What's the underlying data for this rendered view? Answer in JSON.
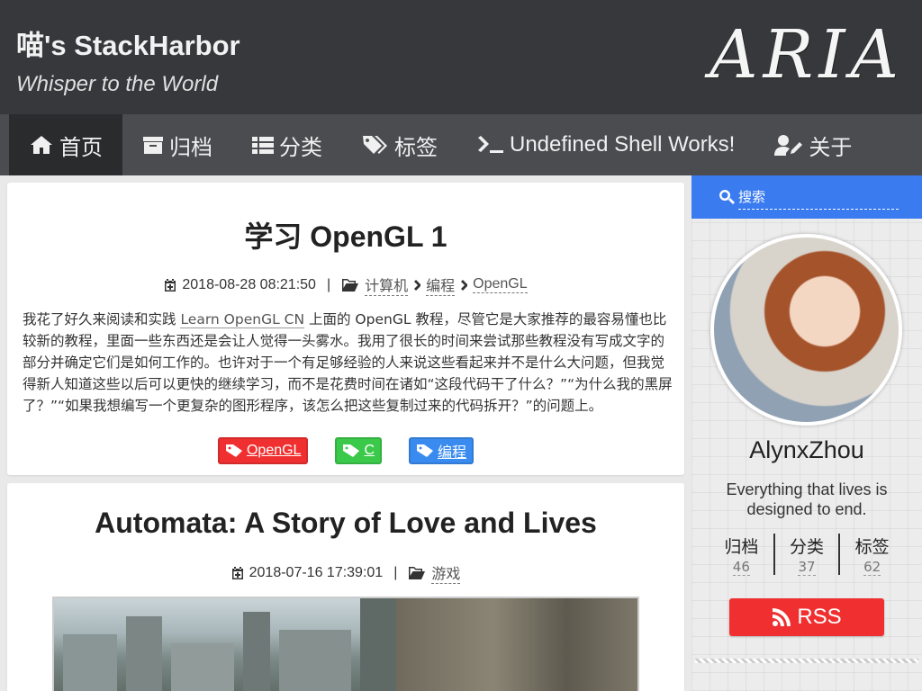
{
  "site": {
    "title": "喵's StackHarbor",
    "subtitle": "Whisper to the World",
    "logo_text": "ARIA"
  },
  "nav": {
    "items": [
      {
        "label": "首页",
        "icon": "home-icon",
        "active": true
      },
      {
        "label": "归档",
        "icon": "archive-icon"
      },
      {
        "label": "分类",
        "icon": "list-icon"
      },
      {
        "label": "标签",
        "icon": "tags-icon"
      },
      {
        "label": "Undefined Shell Works!",
        "icon": "terminal-icon"
      },
      {
        "label": "关于",
        "icon": "user-edit-icon"
      }
    ]
  },
  "posts": [
    {
      "title": "学习 OpenGL 1",
      "date": "2018-08-28 08:21:50",
      "separator": "|",
      "categories": [
        "计算机",
        "编程",
        "OpenGL"
      ],
      "excerpt_before": "我花了好久来阅读和实践 ",
      "excerpt_link": "Learn OpenGL CN",
      "excerpt_after": " 上面的 OpenGL 教程，尽管它是大家推荐的最容易懂也比较新的教程，里面一些东西还是会让人觉得一头雾水。我用了很长的时间来尝试那些教程没有写成文字的部分并确定它们是如何工作的。也许对于一个有足够经验的人来说这些看起来并不是什么大问题，但我觉得新人知道这些以后可以更快的继续学习，而不是花费时间在诸如“这段代码干了什么？”“为什么我的黑屏了？”“如果我想编写一个更复杂的图形程序，该怎么把这些复制过来的代码拆开？”的问题上。",
      "tags": [
        {
          "label": "OpenGL",
          "color": "#f03030"
        },
        {
          "label": "C",
          "color": "#3bc94a"
        },
        {
          "label": "编程",
          "color": "#3a8bf0"
        }
      ]
    },
    {
      "title": "Automata: A Story of Love and Lives",
      "date": "2018-07-16 17:39:01",
      "separator": "|",
      "categories": [
        "游戏"
      ]
    }
  ],
  "sidebar": {
    "search_placeholder": "搜索",
    "author_name": "AlynxZhou",
    "author_desc": "Everything that lives is designed to end.",
    "stats": [
      {
        "label": "归档",
        "count": "46"
      },
      {
        "label": "分类",
        "count": "37"
      },
      {
        "label": "标签",
        "count": "62"
      }
    ],
    "rss_label": "RSS"
  },
  "colors": {
    "header_bg": "#36383b",
    "nav_bg": "#4a4c4f",
    "search_bg": "#3a7bf0",
    "rss_bg": "#f03030"
  }
}
